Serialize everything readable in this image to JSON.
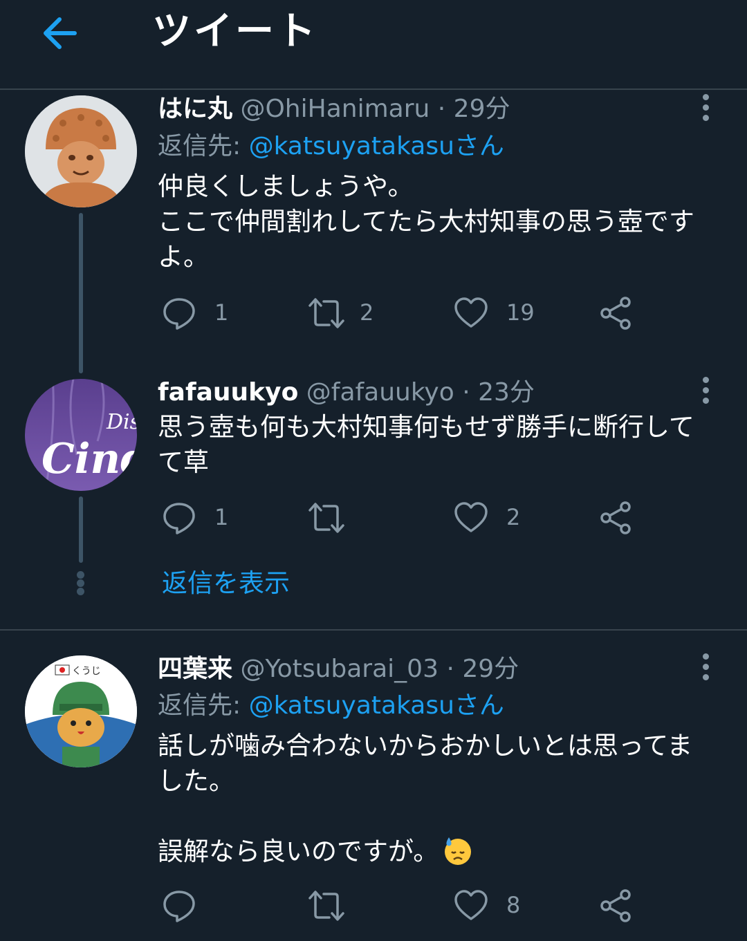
{
  "header": {
    "title": "ツイート"
  },
  "tweets": [
    {
      "name": "はに丸",
      "handle": "@OhiHanimaru",
      "time": "· 29分",
      "reply_prefix": "返信先: ",
      "reply_to": "@katsuyatakasuさん",
      "text_lines": [
        "仲良くしましょうや。",
        "ここで仲間割れしてたら大村知事の思う壺です",
        "よ。"
      ],
      "replies": "1",
      "retweets": "2",
      "likes": "19"
    },
    {
      "name": "fafauukyo",
      "handle": "@fafauukyo",
      "time": "· 23分",
      "avatar_text": "Cind",
      "avatar_small": "Dis",
      "text_lines": [
        "思う壺も何も大村知事何もせず勝手に断行して",
        "て草"
      ],
      "replies": "1",
      "retweets": "",
      "likes": "2"
    },
    {
      "name": "四葉来",
      "handle": "@Yotsubarai_03",
      "time": "· 29分",
      "reply_prefix": "返信先: ",
      "reply_to": "@katsuyatakasuさん",
      "avatar_badge": "くうじ",
      "text_lines": [
        "話しが噛み合わないからおかしいとは思ってま",
        "した。",
        "",
        "誤解なら良いのですが。"
      ],
      "replies": "",
      "retweets": "",
      "likes": "8"
    }
  ],
  "show_replies": "返信を表示",
  "colors": {
    "background": "#15202b",
    "accent": "#1da1f2",
    "secondary": "#8899a6",
    "divider": "#38444d"
  },
  "icons": [
    "back-arrow-icon",
    "reply-icon",
    "retweet-icon",
    "like-icon",
    "share-icon",
    "more-icon",
    "sweat-emoji-icon"
  ]
}
